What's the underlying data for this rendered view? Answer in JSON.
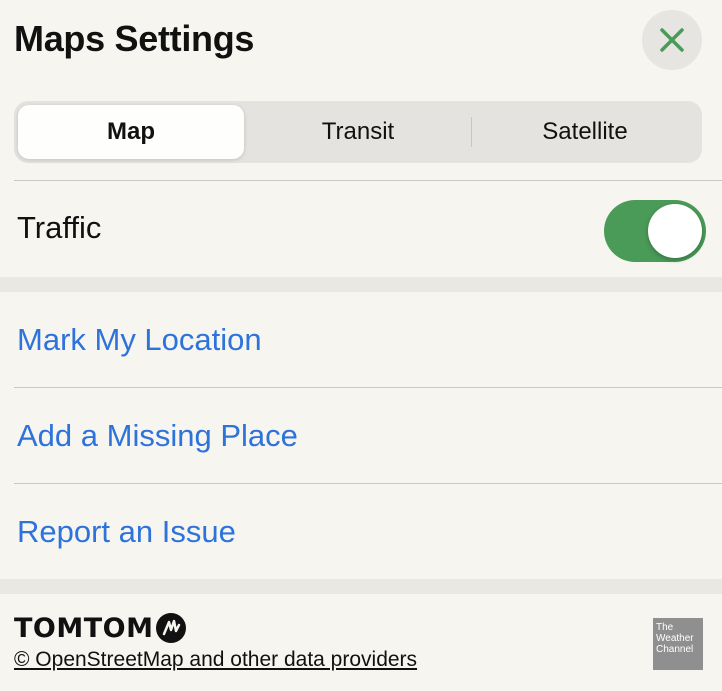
{
  "header": {
    "title": "Maps Settings",
    "close_icon": "close-icon",
    "accent_color": "#4a9a58"
  },
  "map_type": {
    "options": [
      "Map",
      "Transit",
      "Satellite"
    ],
    "selected": "Map"
  },
  "traffic": {
    "label": "Traffic",
    "enabled": true,
    "toggle_color": "#4a9a58"
  },
  "actions": {
    "mark_location": "Mark My Location",
    "add_place": "Add a Missing Place",
    "report_issue": "Report an Issue",
    "link_color": "#2e73db"
  },
  "footer": {
    "tomtom": "TOMTOM",
    "osm_credit": "© OpenStreetMap and other data providers",
    "weather_logo": "The Weather Channel"
  }
}
